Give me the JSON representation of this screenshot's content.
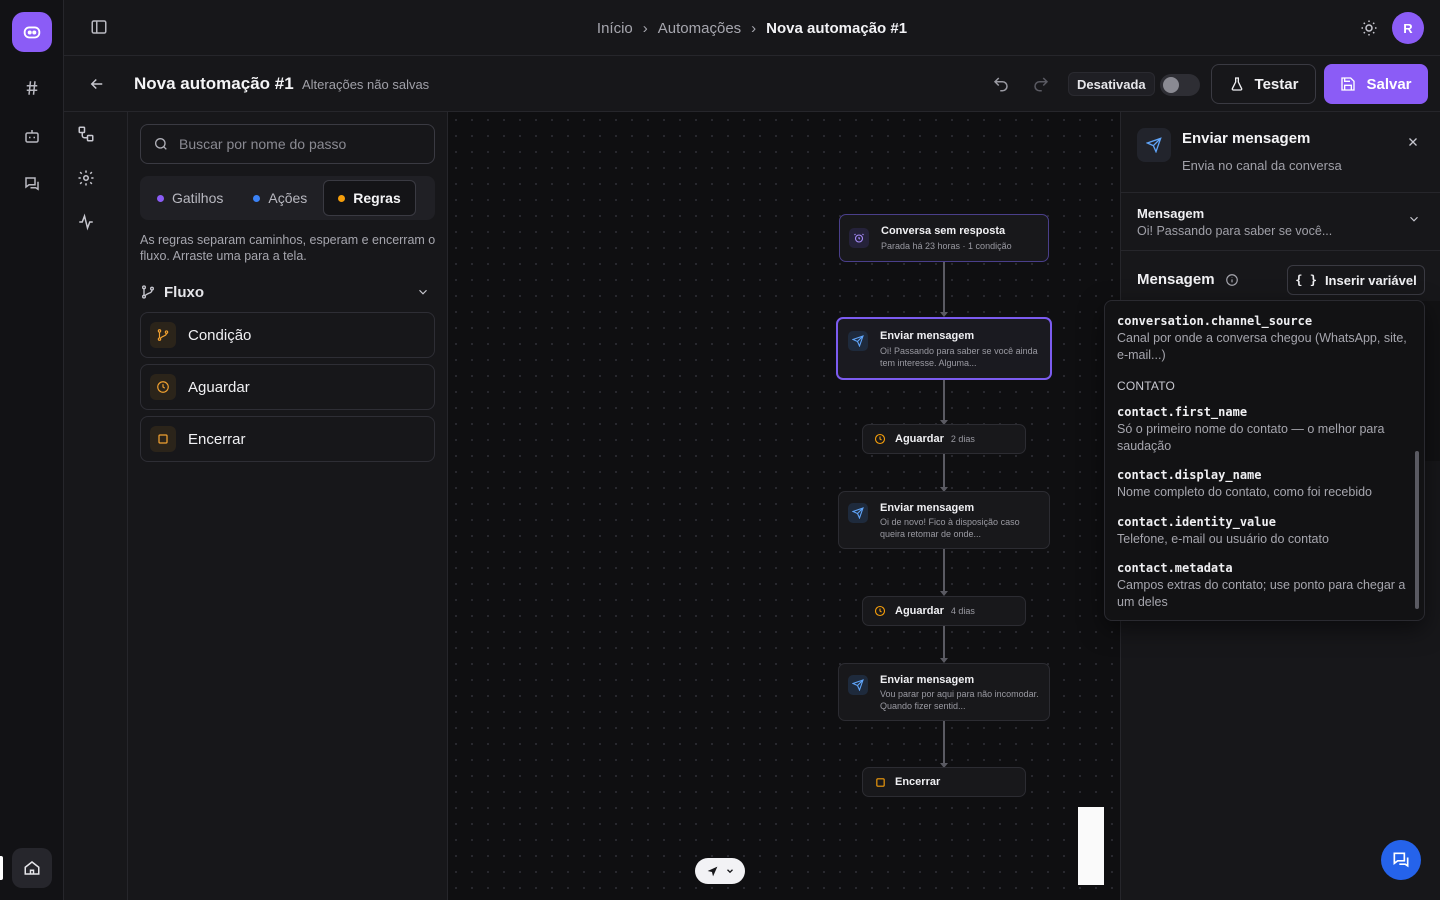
{
  "breadcrumb": {
    "items": [
      "Início",
      "Automações"
    ],
    "current": "Nova automação #1"
  },
  "user": {
    "initial": "R"
  },
  "header": {
    "title": "Nova automação #1",
    "unsaved": "Alterações não salvas",
    "status": "Desativada",
    "test_label": "Testar",
    "save_label": "Salvar"
  },
  "left_panel": {
    "search_placeholder": "Buscar por nome do passo",
    "tabs": [
      {
        "label": "Gatilhos",
        "color": "#8b5cf6"
      },
      {
        "label": "Ações",
        "color": "#3b82f6"
      },
      {
        "label": "Regras",
        "color": "#f59e0b"
      }
    ],
    "active_tab": "Regras",
    "hint": "As regras separam caminhos, esperam e encerram o fluxo. Arraste uma para a tela.",
    "group": "Fluxo",
    "items": [
      {
        "label": "Condição",
        "icon": "branch-icon"
      },
      {
        "label": "Aguardar",
        "icon": "clock-icon"
      },
      {
        "label": "Encerrar",
        "icon": "stop-icon"
      }
    ]
  },
  "canvas": {
    "nodes": [
      {
        "title": "Conversa sem resposta",
        "subtitle": "Parada há 23 horas · 1 condição",
        "icon": "alarm-icon"
      },
      {
        "title": "Enviar mensagem",
        "subtitle": "Oi! Passando para saber se você ainda tem interesse. Alguma...",
        "icon": "send-icon"
      },
      {
        "title": "Aguardar",
        "extra": "2 dias",
        "icon": "clock-icon"
      },
      {
        "title": "Enviar mensagem",
        "subtitle": "Oi de novo! Fico à disposição caso queira retomar de onde...",
        "icon": "send-icon"
      },
      {
        "title": "Aguardar",
        "extra": "4 dias",
        "icon": "clock-icon"
      },
      {
        "title": "Enviar mensagem",
        "subtitle": "Vou parar por aqui para não incomodar. Quando fizer sentid...",
        "icon": "send-icon"
      },
      {
        "title": "Encerrar",
        "icon": "stop-icon"
      }
    ]
  },
  "right_panel": {
    "title": "Enviar mensagem",
    "subtitle": "Envia no canal da conversa",
    "accordion_title": "Mensagem",
    "accordion_preview": "Oi! Passando para saber se você...",
    "message_label": "Mensagem",
    "insert_variable": "Inserir variável"
  },
  "variables": {
    "top": [
      {
        "key": "conversation.channel_source",
        "desc": "Canal por onde a conversa chegou (WhatsApp, site, e-mail...)"
      }
    ],
    "section": "CONTATO",
    "contact": [
      {
        "key": "contact.first_name",
        "desc": "Só o primeiro nome do contato — o melhor para saudação"
      },
      {
        "key": "contact.display_name",
        "desc": "Nome completo do contato, como foi recebido"
      },
      {
        "key": "contact.identity_value",
        "desc": "Telefone, e-mail ou usuário do contato"
      },
      {
        "key": "contact.metadata",
        "desc": "Campos extras do contato; use ponto para chegar a um deles"
      }
    ]
  },
  "colors": {
    "accent": "#8b5cf6",
    "send": "#60a5fa",
    "rule": "#f59e0b",
    "fab": "#2563eb"
  }
}
